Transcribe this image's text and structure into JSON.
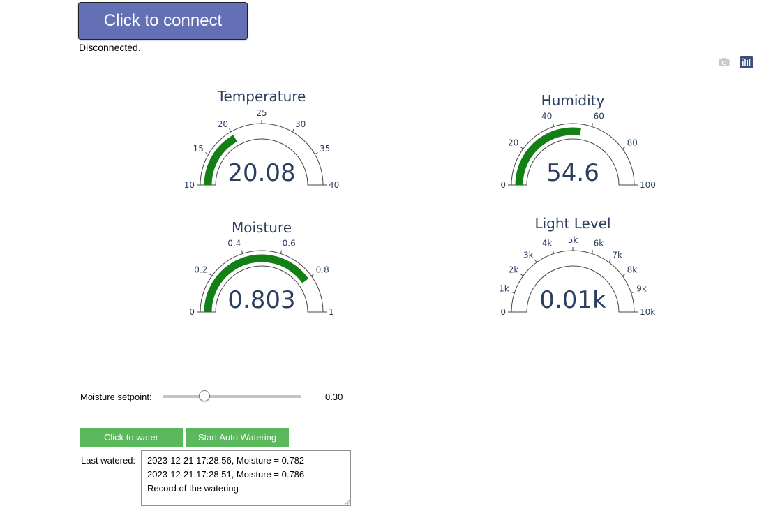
{
  "connect": {
    "label": "Click to connect",
    "status": "Disconnected."
  },
  "modebar": {
    "icons": [
      "camera-icon",
      "plotly-logo-icon"
    ]
  },
  "colors": {
    "gauge_bar": "#138016",
    "gauge_text": "#2a3f5f",
    "button_green": "#5cb85c",
    "connect_button": "#6470b5"
  },
  "gauges": [
    {
      "title": "Temperature",
      "value": 20.08,
      "value_text": "20.08",
      "range": [
        10,
        40
      ],
      "ticks": [
        10,
        15,
        20,
        25,
        30,
        35,
        40
      ],
      "tick_labels": [
        "10",
        "15",
        "20",
        "25",
        "30",
        "35",
        "40"
      ]
    },
    {
      "title": "Humidity",
      "value": 54.6,
      "value_text": "54.6",
      "range": [
        0,
        100
      ],
      "ticks": [
        0,
        20,
        40,
        60,
        80,
        100
      ],
      "tick_labels": [
        "0",
        "20",
        "40",
        "60",
        "80",
        "100"
      ]
    },
    {
      "title": "Moisture",
      "value": 0.803,
      "value_text": "0.803",
      "range": [
        0,
        1
      ],
      "ticks": [
        0,
        0.2,
        0.4,
        0.6,
        0.8,
        1
      ],
      "tick_labels": [
        "0",
        "0.2",
        "0.4",
        "0.6",
        "0.8",
        "1"
      ]
    },
    {
      "title": "Light Level",
      "value": 10,
      "value_text": "0.01k",
      "range": [
        0,
        10000
      ],
      "ticks": [
        0,
        1000,
        2000,
        3000,
        4000,
        5000,
        6000,
        7000,
        8000,
        9000,
        10000
      ],
      "tick_labels": [
        "0",
        "1k",
        "2k",
        "3k",
        "4k",
        "5k",
        "6k",
        "7k",
        "8k",
        "9k",
        "10k"
      ]
    }
  ],
  "setpoint": {
    "label": "Moisture setpoint:",
    "value": 0.3,
    "value_text": "0.30",
    "min": 0,
    "max": 1
  },
  "buttons": {
    "water": "Click to water",
    "auto": "Start Auto Watering"
  },
  "watering": {
    "label": "Last watered:",
    "log": [
      "2023-12-21 17:28:56, Moisture = 0.782",
      "2023-12-21 17:28:51, Moisture = 0.786",
      "Record of the watering"
    ]
  }
}
